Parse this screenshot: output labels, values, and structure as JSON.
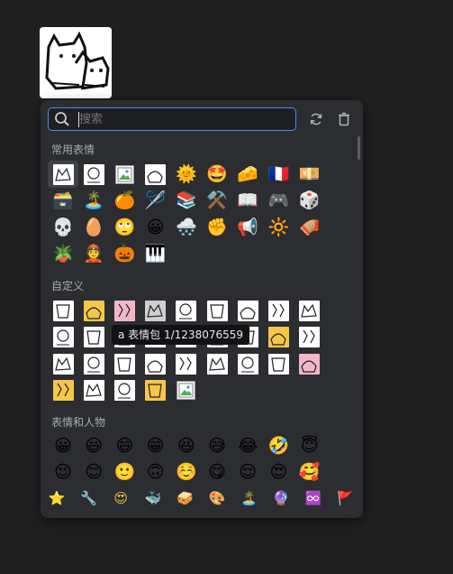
{
  "search": {
    "value": "",
    "placeholder": "搜索"
  },
  "sections": {
    "frequent": "常用表情",
    "custom": "自定义",
    "people": "表情和人物"
  },
  "tooltip": "a 表情包 1/1238076559",
  "frequent_items": [
    {
      "type": "sticker",
      "name": "sticker-1"
    },
    {
      "type": "sticker",
      "name": "sticker-2"
    },
    {
      "type": "broken",
      "name": "broken-image"
    },
    {
      "type": "sticker",
      "name": "sticker-3"
    },
    {
      "type": "emoji",
      "glyph": "🌞",
      "name": "sun-with-face"
    },
    {
      "type": "emoji",
      "glyph": "🤩",
      "name": "star-struck"
    },
    {
      "type": "emoji",
      "glyph": "🧀",
      "name": "cheese"
    },
    {
      "type": "emoji",
      "glyph": "🇫🇷",
      "name": "france-flag"
    },
    {
      "type": "emoji",
      "glyph": "💴",
      "name": "banknote"
    },
    {
      "type": "emoji",
      "glyph": "🗃️",
      "name": "card-file-box"
    },
    {
      "type": "emoji",
      "glyph": "🏝️",
      "name": "desert-island"
    },
    {
      "type": "emoji",
      "glyph": "🍊",
      "name": "tangerine"
    },
    {
      "type": "emoji",
      "glyph": "🪡",
      "name": "sewing-needle"
    },
    {
      "type": "emoji",
      "glyph": "📚",
      "name": "books"
    },
    {
      "type": "emoji",
      "glyph": "⚒️",
      "name": "hammer-and-pick"
    },
    {
      "type": "emoji",
      "glyph": "📖",
      "name": "open-book"
    },
    {
      "type": "emoji",
      "glyph": "🎮",
      "name": "video-game"
    },
    {
      "type": "emoji",
      "glyph": "🎲",
      "name": "game-die"
    },
    {
      "type": "emoji",
      "glyph": "💀",
      "name": "skull"
    },
    {
      "type": "emoji",
      "glyph": "🥚",
      "name": "egg"
    },
    {
      "type": "emoji",
      "glyph": "🙄",
      "name": "rolling-eyes"
    },
    {
      "type": "emoji",
      "glyph": "😀",
      "name": "grinning"
    },
    {
      "type": "emoji",
      "glyph": "🌨️",
      "name": "cloud-with-snow"
    },
    {
      "type": "emoji",
      "glyph": "✊",
      "name": "raised-fist"
    },
    {
      "type": "emoji",
      "glyph": "📢",
      "name": "loudspeaker"
    },
    {
      "type": "emoji",
      "glyph": "🔆",
      "name": "bright-button"
    },
    {
      "type": "emoji",
      "glyph": "🪗",
      "name": "accordion"
    },
    {
      "type": "emoji",
      "glyph": "🪴",
      "name": "potted-plant"
    },
    {
      "type": "emoji",
      "glyph": "👲",
      "name": "person-with-cap"
    },
    {
      "type": "emoji",
      "glyph": "🎃",
      "name": "jack-o-lantern"
    },
    {
      "type": "emoji",
      "glyph": "🎹",
      "name": "musical-keyboard"
    }
  ],
  "custom_items": [
    {
      "style": "white",
      "name": "custom-sticker"
    },
    {
      "style": "yellow",
      "name": "custom-sticker"
    },
    {
      "style": "pink",
      "name": "custom-sticker"
    },
    {
      "style": "dark",
      "name": "custom-sticker"
    },
    {
      "style": "white",
      "name": "custom-sticker"
    },
    {
      "style": "white",
      "name": "custom-sticker"
    },
    {
      "style": "white",
      "name": "custom-sticker"
    },
    {
      "style": "white",
      "name": "custom-sticker"
    },
    {
      "style": "white",
      "name": "custom-sticker"
    },
    {
      "style": "white",
      "name": "custom-sticker"
    },
    {
      "style": "white",
      "name": "custom-sticker"
    },
    {
      "style": "white",
      "name": "custom-sticker"
    },
    {
      "style": "white",
      "name": "custom-sticker"
    },
    {
      "style": "white",
      "name": "custom-sticker"
    },
    {
      "style": "white",
      "name": "custom-sticker"
    },
    {
      "style": "white",
      "name": "custom-sticker"
    },
    {
      "style": "yellow",
      "name": "custom-sticker"
    },
    {
      "style": "white",
      "name": "custom-sticker"
    },
    {
      "style": "white",
      "name": "custom-sticker"
    },
    {
      "style": "white",
      "name": "custom-sticker"
    },
    {
      "style": "white",
      "name": "custom-sticker"
    },
    {
      "style": "white",
      "name": "custom-sticker"
    },
    {
      "style": "white",
      "name": "custom-sticker"
    },
    {
      "style": "white",
      "name": "custom-sticker"
    },
    {
      "style": "white",
      "name": "custom-sticker"
    },
    {
      "style": "white",
      "name": "custom-sticker"
    },
    {
      "style": "pink",
      "name": "custom-sticker"
    },
    {
      "style": "yellow",
      "name": "custom-sticker"
    },
    {
      "style": "white",
      "name": "custom-sticker"
    },
    {
      "style": "white",
      "name": "custom-sticker"
    },
    {
      "style": "yellow",
      "name": "custom-sticker"
    },
    {
      "style": "broken",
      "name": "broken-image"
    }
  ],
  "people_items": [
    {
      "glyph": "😀",
      "name": "grinning"
    },
    {
      "glyph": "😃",
      "name": "smiley"
    },
    {
      "glyph": "😄",
      "name": "smile"
    },
    {
      "glyph": "😁",
      "name": "grin"
    },
    {
      "glyph": "😆",
      "name": "laughing"
    },
    {
      "glyph": "😅",
      "name": "sweat-smile"
    },
    {
      "glyph": "😂",
      "name": "joy"
    },
    {
      "glyph": "🤣",
      "name": "rofl"
    },
    {
      "glyph": "😇",
      "name": "innocent"
    },
    {
      "glyph": "😉",
      "name": "wink"
    },
    {
      "glyph": "😊",
      "name": "blush"
    },
    {
      "glyph": "🙂",
      "name": "slight-smile"
    },
    {
      "glyph": "🙃",
      "name": "upside-down"
    },
    {
      "glyph": "☺️",
      "name": "relaxed"
    },
    {
      "glyph": "😋",
      "name": "yum"
    },
    {
      "glyph": "😌",
      "name": "relieved"
    },
    {
      "glyph": "😍",
      "name": "heart-eyes"
    },
    {
      "glyph": "🥰",
      "name": "smiling-hearts"
    }
  ],
  "category_bar": [
    {
      "glyph": "⭐",
      "name": "category-frequent-icon",
      "color": "#e8a23a"
    },
    {
      "glyph": "🔧",
      "name": "category-custom-icon",
      "color": "#9aa0a6"
    },
    {
      "glyph": "😍",
      "name": "category-people-icon",
      "color": "#f0c040"
    },
    {
      "glyph": "🐳",
      "name": "category-nature-icon",
      "color": "#4a9be8"
    },
    {
      "glyph": "🥪",
      "name": "category-food-icon",
      "color": "#e8b040"
    },
    {
      "glyph": "🎨",
      "name": "category-activity-icon",
      "color": "#c07a40"
    },
    {
      "glyph": "🏝️",
      "name": "category-travel-icon",
      "color": "#40a060"
    },
    {
      "glyph": "🔮",
      "name": "category-objects-icon",
      "color": "#a060c0"
    },
    {
      "glyph": "♾️",
      "name": "category-symbols-icon",
      "color": "#4aa8e8"
    },
    {
      "glyph": "🚩",
      "name": "category-flags-icon",
      "color": "#e04040"
    }
  ]
}
